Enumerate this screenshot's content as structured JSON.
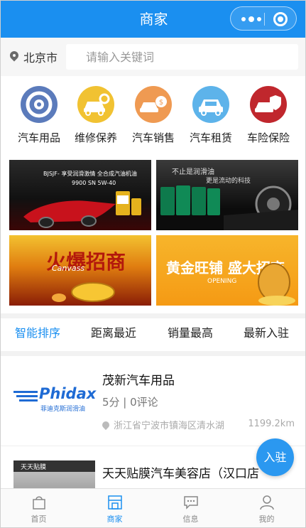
{
  "header": {
    "title": "商家"
  },
  "search": {
    "city": "北京市",
    "placeholder": "请输入关键词"
  },
  "categories": [
    {
      "label": "汽车用品",
      "icon": "tire-icon",
      "color": "#5b7bbb"
    },
    {
      "label": "维修保养",
      "icon": "repair-car-icon",
      "color": "#f1c232"
    },
    {
      "label": "汽车销售",
      "icon": "car-sale-icon",
      "color": "#ef9a52"
    },
    {
      "label": "汽车租赁",
      "icon": "car-rental-icon",
      "color": "#5db3ea"
    },
    {
      "label": "车险保险",
      "icon": "car-insurance-icon",
      "color": "#c0272d"
    }
  ],
  "banners": [
    {
      "caption": "BJSJF- 享受润滑激情  全合成汽油机油",
      "sub": "9900 SN 5W-40"
    },
    {
      "caption": "不止是润滑油",
      "sub": "更是流动的科技"
    },
    {
      "caption": "火爆招商",
      "sub": "Canvass"
    },
    {
      "caption": "黄金旺铺 盛大招商",
      "sub": "OPENING"
    }
  ],
  "sort_tabs": [
    "智能排序",
    "距离最近",
    "销量最高",
    "最新入驻"
  ],
  "shops": [
    {
      "name": "茂新汽车用品",
      "score": "5分 | 0评论",
      "address": "浙江省宁波市镇海区清水湖",
      "distance": "1199.2km",
      "logo_text": "Phidax",
      "logo_sub": "菲迪克斯润滑油"
    },
    {
      "name": "天天贴膜汽车美容店（汉口店",
      "logo_text": "天天贴膜"
    }
  ],
  "join_button": "入驻",
  "nav": [
    {
      "label": "首页",
      "icon": "shop-bag-icon"
    },
    {
      "label": "商家",
      "icon": "store-icon"
    },
    {
      "label": "信息",
      "icon": "message-icon"
    },
    {
      "label": "我的",
      "icon": "user-icon"
    }
  ],
  "colors": {
    "primary": "#1a8ff0"
  }
}
